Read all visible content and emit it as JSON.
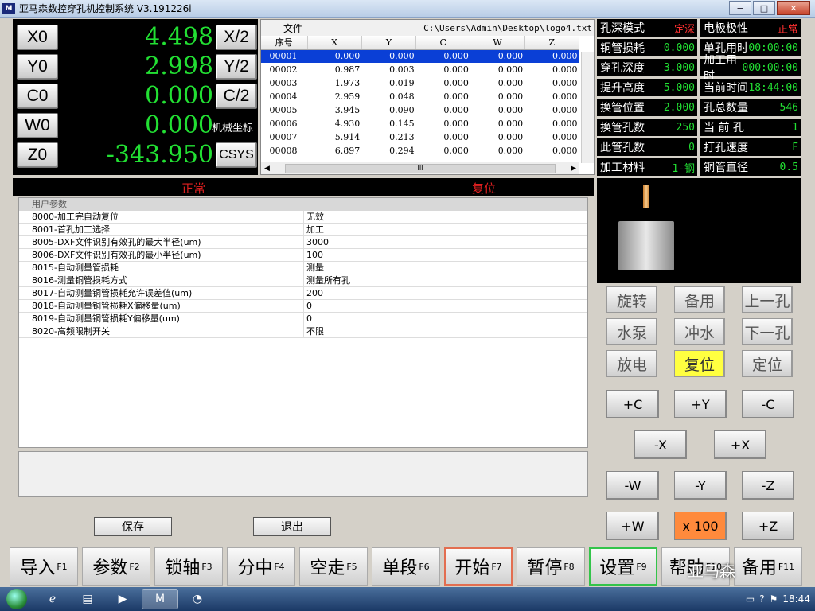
{
  "window": {
    "title": "亚马森数控穿孔机控制系统 V3.191226i",
    "logo": "M",
    "min": "−",
    "max": "□",
    "close": "✕"
  },
  "axes": [
    {
      "label": "X0",
      "value": "4.498",
      "btn": "X/2"
    },
    {
      "label": "Y0",
      "value": "2.998",
      "btn": "Y/2"
    },
    {
      "label": "C0",
      "value": "0.000",
      "btn": "C/2"
    },
    {
      "label": "W0",
      "value": "0.000",
      "btn": "机械坐标"
    },
    {
      "label": "Z0",
      "value": "-343.950",
      "btn": "CSYS"
    }
  ],
  "file": {
    "label": "文件",
    "path": "C:\\Users\\Admin\\Desktop\\logo4.txt",
    "columns": [
      "序号",
      "X",
      "Y",
      "C",
      "W",
      "Z"
    ],
    "rows": [
      [
        "00001",
        "0.000",
        "0.000",
        "0.000",
        "0.000",
        "0.000"
      ],
      [
        "00002",
        "0.987",
        "0.003",
        "0.000",
        "0.000",
        "0.000"
      ],
      [
        "00003",
        "1.973",
        "0.019",
        "0.000",
        "0.000",
        "0.000"
      ],
      [
        "00004",
        "2.959",
        "0.048",
        "0.000",
        "0.000",
        "0.000"
      ],
      [
        "00005",
        "3.945",
        "0.090",
        "0.000",
        "0.000",
        "0.000"
      ],
      [
        "00006",
        "4.930",
        "0.145",
        "0.000",
        "0.000",
        "0.000"
      ],
      [
        "00007",
        "5.914",
        "0.213",
        "0.000",
        "0.000",
        "0.000"
      ],
      [
        "00008",
        "6.897",
        "0.294",
        "0.000",
        "0.000",
        "0.000"
      ]
    ],
    "scroll_mark": "III"
  },
  "status": [
    {
      "label": "孔深模式",
      "value": "定深",
      "red": true
    },
    {
      "label": "电极极性",
      "value": "正常",
      "red": true
    },
    {
      "label": "铜管损耗",
      "value": "0.000"
    },
    {
      "label": "单孔用时",
      "value": "00:00:00"
    },
    {
      "label": "穿孔深度",
      "value": "3.000"
    },
    {
      "label": "加工用时",
      "value": "000:00:00"
    },
    {
      "label": "提升高度",
      "value": "5.000"
    },
    {
      "label": "当前时间",
      "value": "18:44:00"
    },
    {
      "label": "换管位置",
      "value": "2.000"
    },
    {
      "label": "孔总数量",
      "value": "546"
    },
    {
      "label": "换管孔数",
      "value": "250"
    },
    {
      "label": "当 前 孔",
      "value": "1"
    },
    {
      "label": "此管孔数",
      "value": "0"
    },
    {
      "label": "打孔速度",
      "value": "F"
    },
    {
      "label": "加工材料",
      "value": "1-钢"
    },
    {
      "label": "铜管直径",
      "value": "0.5"
    }
  ],
  "state": {
    "left": "正常",
    "right": "复位"
  },
  "params": {
    "header": "用户参数",
    "rows": [
      [
        "8000-加工完自动复位",
        "无效"
      ],
      [
        "8001-首孔加工选择",
        "加工"
      ],
      [
        "8005-DXF文件识别有效孔的最大半径(um)",
        "3000"
      ],
      [
        "8006-DXF文件识别有效孔的最小半径(um)",
        "100"
      ],
      [
        "8015-自动测量管损耗",
        "测量"
      ],
      [
        "8016-测量铜管损耗方式",
        "测量所有孔"
      ],
      [
        "8017-自动测量铜管损耗允许误差值(um)",
        "200"
      ],
      [
        "8018-自动测量铜管损耗X偏移量(um)",
        "0"
      ],
      [
        "8019-自动测量铜管损耗Y偏移量(um)",
        "0"
      ],
      [
        "8020-高频限制开关",
        "不限"
      ]
    ]
  },
  "actions": {
    "save": "保存",
    "exit": "退出"
  },
  "controls": [
    "旋转",
    "备用",
    "上一孔",
    "水泵",
    "冲水",
    "下一孔",
    "放电",
    "复位",
    "定位"
  ],
  "jog": {
    "cp": "+C",
    "yp": "+Y",
    "cm": "-C",
    "xm": "-X",
    "xp": "+X",
    "wm": "-W",
    "ym": "-Y",
    "zm": "-Z",
    "wp": "+W",
    "mult": "x 100",
    "zp": "+Z"
  },
  "fkeys": [
    {
      "label": "导入",
      "key": "F1"
    },
    {
      "label": "参数",
      "key": "F2"
    },
    {
      "label": "锁轴",
      "key": "F3"
    },
    {
      "label": "分中",
      "key": "F4"
    },
    {
      "label": "空走",
      "key": "F5"
    },
    {
      "label": "单段",
      "key": "F6"
    },
    {
      "label": "开始",
      "key": "F7"
    },
    {
      "label": "暂停",
      "key": "F8"
    },
    {
      "label": "设置",
      "key": "F9"
    },
    {
      "label": "帮助",
      "key": "F10"
    },
    {
      "label": "备用",
      "key": "F11"
    }
  ],
  "watermark": "亚马森",
  "taskbar": {
    "app_logo": "M",
    "time": "18:44"
  }
}
